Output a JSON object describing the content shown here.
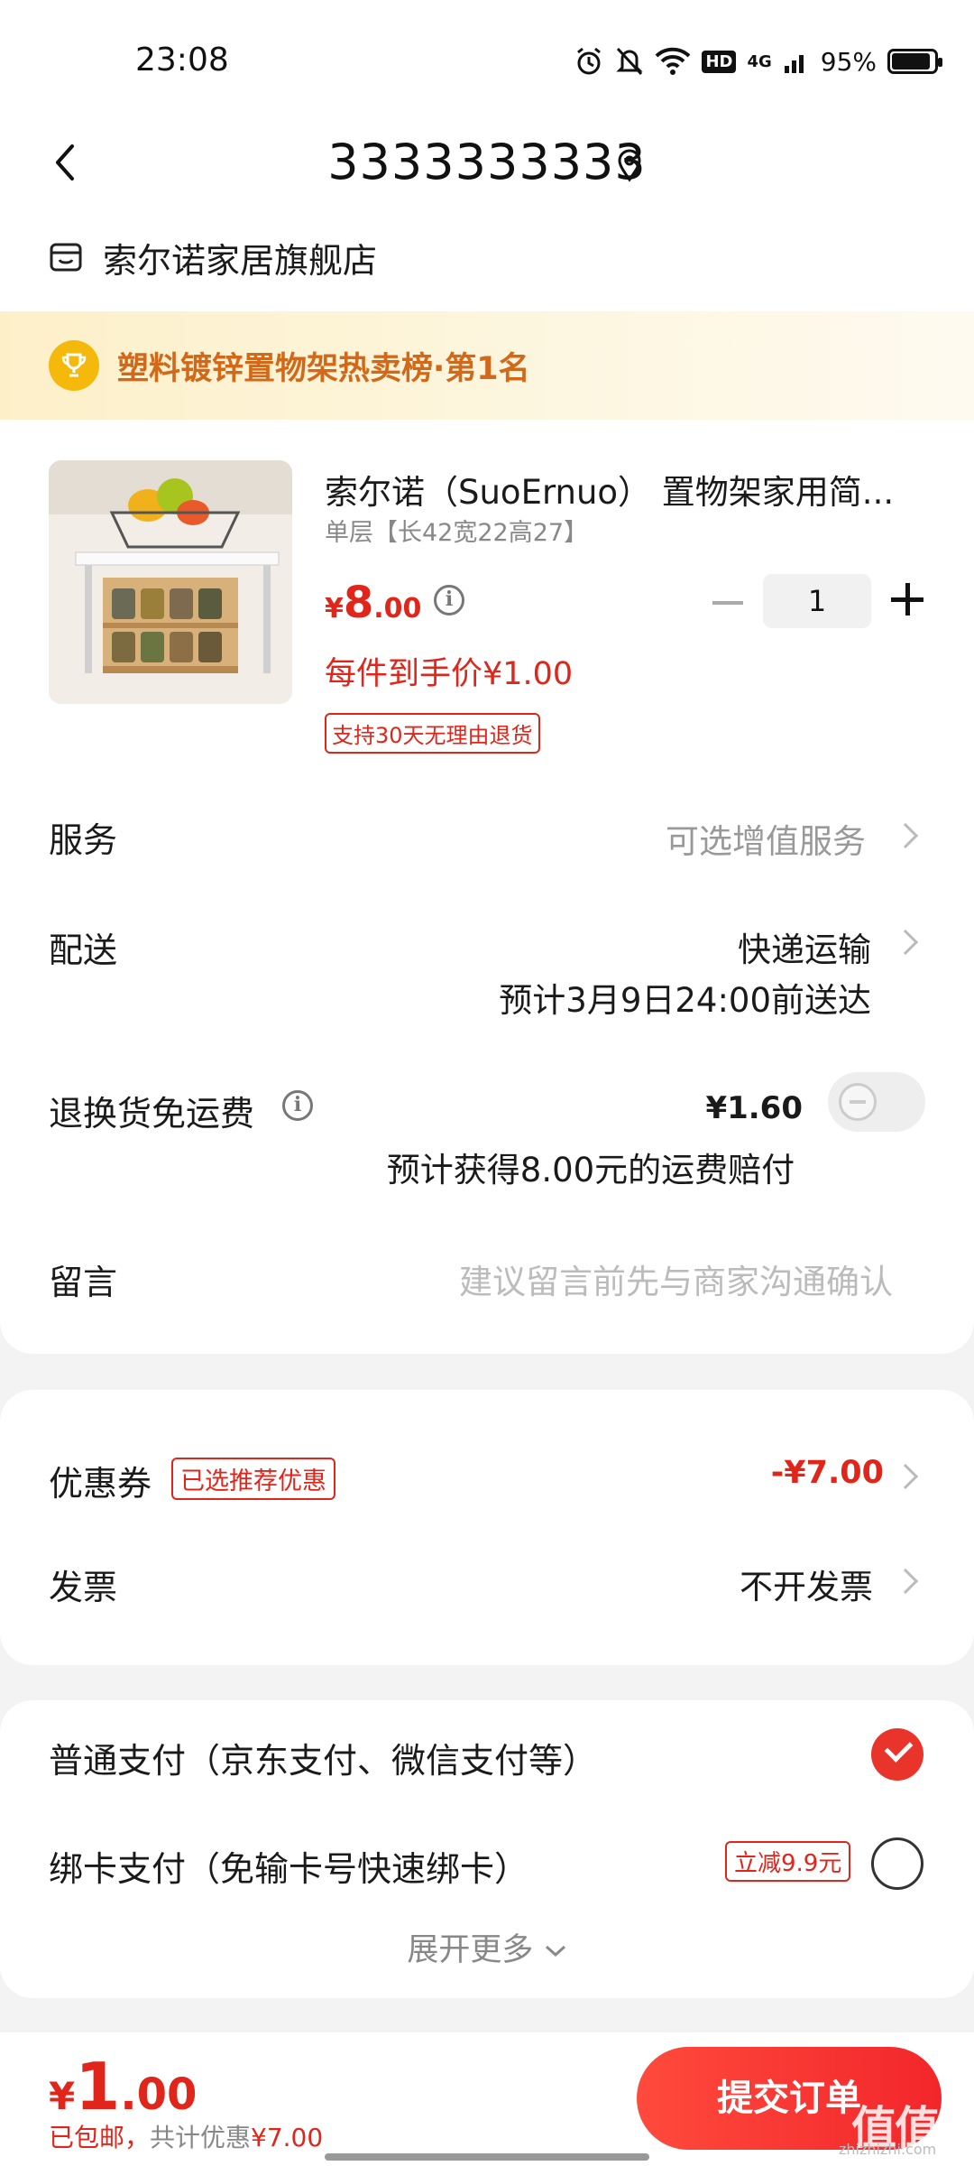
{
  "status_bar": {
    "time": "23:08",
    "network": "4G",
    "hd": "HD",
    "battery": "95%",
    "icons": [
      "alarm-icon",
      "mute-icon",
      "wifi-icon",
      "hd-icon",
      "signal-icon",
      "battery-icon"
    ]
  },
  "header": {
    "title": "3333333333"
  },
  "shop": {
    "name": "索尔诺家居旗舰店"
  },
  "rank_banner": {
    "text": "塑料镀锌置物架热卖榜·第1名"
  },
  "product": {
    "title": "索尔诺（SuoErnuo） 置物架家用简...",
    "spec": "单层【长42宽22高27】",
    "price_symbol": "¥",
    "price_int": "8",
    "price_dec": ".00",
    "unit_price": "每件到手价¥1.00",
    "return_badge": "支持30天无理由退货",
    "quantity": "1"
  },
  "rows": {
    "service_label": "服务",
    "service_value": "可选增值服务",
    "delivery_label": "配送",
    "delivery_value": "快递运输",
    "delivery_eta": "预计3月9日24:00前送达",
    "freight_label": "退换货免运费",
    "freight_price": "¥1.60",
    "freight_note": "预计获得8.00元的运费赔付",
    "freight_enabled": false,
    "message_label": "留言",
    "message_placeholder": "建议留言前先与商家沟通确认"
  },
  "discounts": {
    "coupon_label": "优惠券",
    "coupon_tag": "已选推荐优惠",
    "coupon_value": "-¥7.00",
    "invoice_label": "发票",
    "invoice_value": "不开发票"
  },
  "payment": {
    "option1": "普通支付（京东支付、微信支付等）",
    "option1_selected": true,
    "option2": "绑卡支付（免输卡号快速绑卡）",
    "option2_tag": "立减9.9元",
    "option2_selected": false,
    "expand": "展开更多"
  },
  "bottom": {
    "total_symbol": "¥",
    "total_int": "1",
    "total_dec": ".00",
    "note_red": "已包邮，",
    "note_grey": "共计优惠",
    "note_amount": "¥7.00",
    "submit": "提交订单",
    "watermark": "值值值",
    "watermark_sub": "zhizhizhi.com"
  },
  "colors": {
    "accent": "#e0251b",
    "banner_text": "#d2691a",
    "trophy": "#f5b90b"
  }
}
